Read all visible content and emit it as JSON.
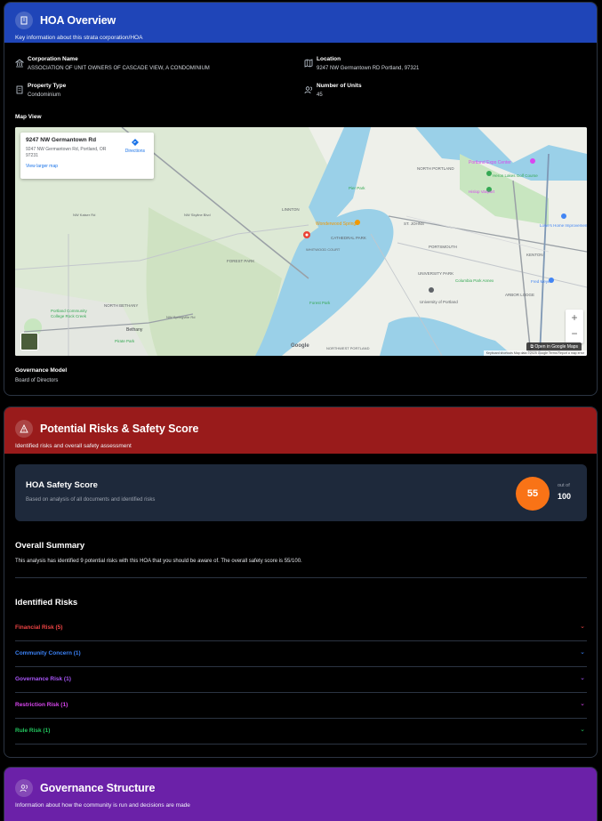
{
  "hoa": {
    "title": "HOA Overview",
    "subtitle": "Key information about this strata corporation/HOA",
    "corporation_label": "Corporation Name",
    "corporation_value": "ASSOCIATION OF UNIT OWNERS OF CASCADE VIEW, A CONDOMINIUM",
    "location_label": "Location",
    "location_value": "9247 NW Germantown RD Portland, 97321",
    "property_type_label": "Property Type",
    "property_type_value": "Condominium",
    "units_label": "Number of Units",
    "units_value": "45",
    "map_label": "Map View",
    "governance_model_label": "Governance Model",
    "governance_model_value": "Board of Directors"
  },
  "map": {
    "place_title": "9247 NW Germantown Rd",
    "place_address": "9247 NW Germantown Rd, Portland, OR 97231",
    "larger_map_link": "View larger map",
    "directions_label": "Directions",
    "open_in_maps": "Open in Google Maps",
    "google_logo": "Google",
    "footer": "Keyboard shortcuts   Map data ©2025 Google   Terms   Report a map error",
    "labels": [
      "LINNTON",
      "Wonderwood Springs",
      "ST. JOHNS",
      "CATHEDRAL PARK",
      "WHITWOOD COURT",
      "FOREST PARK",
      "PORTSMOUTH",
      "KENTON",
      "UNIVERSITY PARK",
      "ARBOR LODGE",
      "NORTH BETHANY",
      "Bethany",
      "Pirate Park",
      "Forest Park",
      "NORTHWEST PORTLAND",
      "NORTH PORTLAND",
      "Pier Park",
      "Portland Expo Center",
      "Heron Lakes Golf Course",
      "Hislop Vanport",
      "Columbia Park Annex",
      "University of Portland",
      "Portland Community College Rock Creek",
      "NW Springville Rd",
      "NW Kaiser Rd",
      "NW Skyline Blvd",
      "Lowe's Home Improvement",
      "Fred Meyer"
    ]
  },
  "risks": {
    "title": "Potential Risks & Safety Score",
    "subtitle": "Identified risks and overall safety assessment",
    "score_title": "HOA Safety Score",
    "score_subtitle": "Based on analysis of all documents and identified risks",
    "score_value": "55",
    "out_of_label": "out of",
    "out_of_value": "100",
    "summary_title": "Overall Summary",
    "summary_text": "This analysis has identified 9 potential risks with this HOA that you should be aware of. The overall safety score is 55/100.",
    "identified_title": "Identified Risks",
    "items": [
      {
        "label": "Financial Risk (5)",
        "color": "#ef4444"
      },
      {
        "label": "Community Concern (1)",
        "color": "#3b82f6"
      },
      {
        "label": "Governance Risk (1)",
        "color": "#a855f7"
      },
      {
        "label": "Restriction Risk (1)",
        "color": "#d946ef"
      },
      {
        "label": "Rule Risk (1)",
        "color": "#22c55e"
      }
    ]
  },
  "governance": {
    "title": "Governance Structure",
    "subtitle": "Information about how the community is run and decisions are made"
  },
  "colors": {
    "hoa_header": "#1f45b8",
    "risk_header": "#991b1b",
    "gov_header": "#6b21a8",
    "score": "#f97316"
  }
}
